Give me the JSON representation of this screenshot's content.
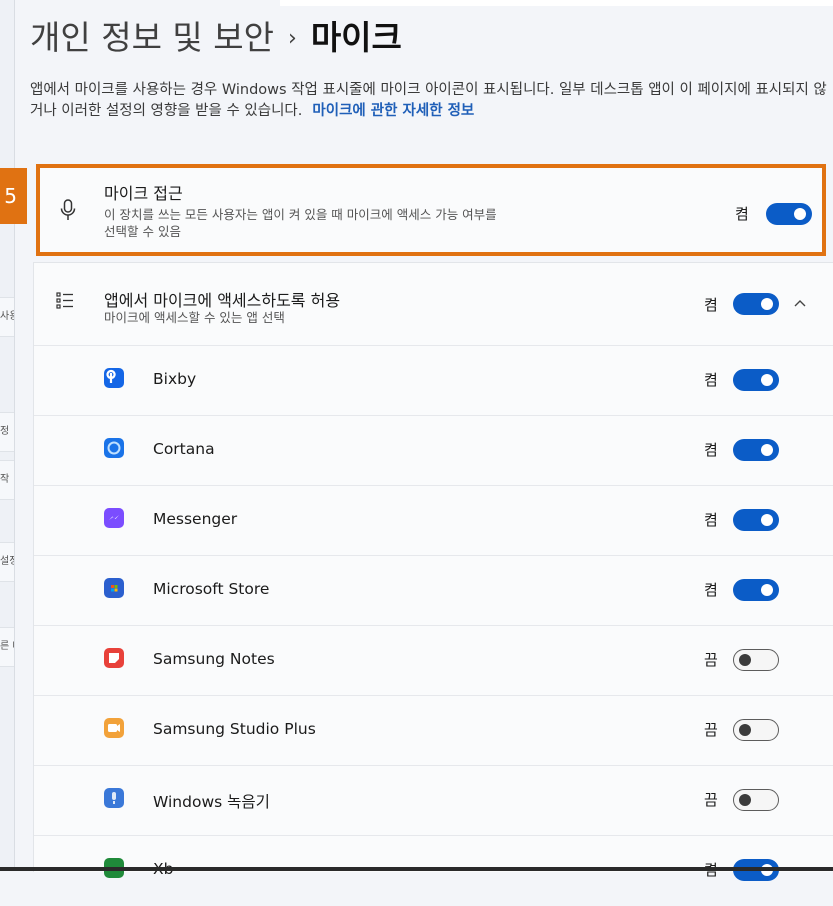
{
  "breadcrumb": {
    "parent": "개인 정보 및 보안",
    "separator": "›",
    "current": "마이크"
  },
  "description": {
    "text": "앱에서 마이크를 사용하는 경우 Windows 작업 표시줄에 마이크 아이콘이 표시됩니다. 일부 데스크톱 앱이 이 페이지에 표시되지 않거나 이러한 설정의 영향을 받을 수 있습니다.",
    "link": "마이크에 관한 자세한 정보"
  },
  "badge": "5",
  "left_fragments": [
    "사용",
    "정",
    "작",
    "설정",
    "른 데"
  ],
  "mic_access": {
    "title": "마이크 접근",
    "subtitle_line1": "이 장치를 쓰는 모든 사용자는 앱이 켜 있을 때 마이크에 액세스 가능 여부를",
    "subtitle_line2": "선택할 수 있음",
    "state": "켬",
    "on": true,
    "icon": "microphone-icon"
  },
  "allow_apps": {
    "title": "앱에서 마이크에 액세스하도록 허용",
    "subtitle": "마이크에 액세스할 수 있는 앱 선택",
    "state": "켬",
    "on": true,
    "icon": "list-icon",
    "expand_icon": "chevron-up-icon"
  },
  "apps": [
    {
      "name": "Bixby",
      "state": "켬",
      "on": true,
      "color": "#1466e6"
    },
    {
      "name": "Cortana",
      "state": "켬",
      "on": true,
      "color": "#1a73e8"
    },
    {
      "name": "Messenger",
      "state": "켬",
      "on": true,
      "color": "#7b4dff"
    },
    {
      "name": "Microsoft Store",
      "state": "켬",
      "on": true,
      "color": "#2b5fce"
    },
    {
      "name": "Samsung Notes",
      "state": "끔",
      "on": false,
      "color": "#e8413a"
    },
    {
      "name": "Samsung Studio Plus",
      "state": "끔",
      "on": false,
      "color": "#f2a23a"
    },
    {
      "name": "Windows 녹음기",
      "state": "끔",
      "on": false,
      "color": "#3a78d8"
    },
    {
      "name": "Xb",
      "state": "켬",
      "on": true,
      "color": "#1f8a3a"
    }
  ],
  "colors": {
    "accent": "#0b5cc7",
    "highlight": "#e07212",
    "link": "#1f5fb8"
  }
}
